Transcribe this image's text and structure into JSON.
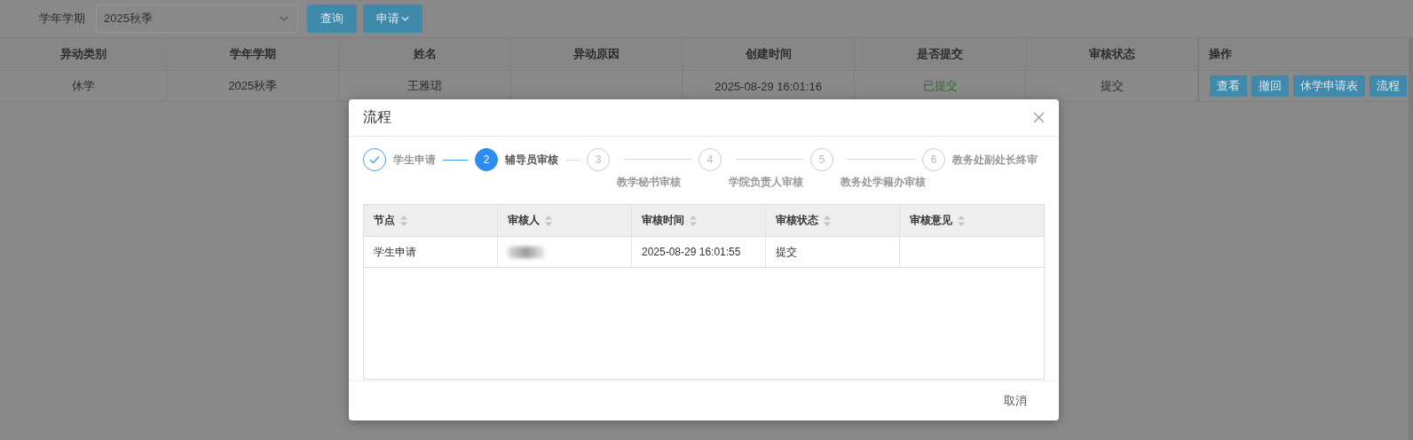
{
  "filter": {
    "label": "学年学期",
    "select_value": "2025秋季",
    "buttons": [
      "查询",
      "申请"
    ]
  },
  "table": {
    "columns": [
      "异动类别",
      "学年学期",
      "姓名",
      "异动原因",
      "创建时间",
      "是否提交",
      "审核状态",
      "操作"
    ],
    "rows": [
      {
        "cells": [
          "休学",
          "2025秋季",
          "王雅珺",
          "",
          "2025-08-29 16:01:16",
          "已提交",
          "提交"
        ],
        "actions": [
          "查看",
          "撤回",
          "休学申请表",
          "流程"
        ]
      }
    ]
  },
  "dialog": {
    "title": "流程",
    "steps": [
      {
        "title": "学生申请",
        "finished": true,
        "selected": false
      },
      {
        "number": "2",
        "title": "辅导员审核",
        "finished": false,
        "selected": true
      },
      {
        "number": "3",
        "title": "教学秘书审核",
        "finished": false,
        "selected": false
      },
      {
        "number": "4",
        "title": "学院负责人审核",
        "finished": false,
        "selected": false
      },
      {
        "number": "5",
        "title": "教务处学籍办审核",
        "finished": false,
        "selected": false
      },
      {
        "number": "6",
        "title": "教务处副处长终审",
        "finished": false,
        "selected": false
      }
    ],
    "table": {
      "columns": [
        "节点",
        "审核人",
        "审核时间",
        "审核状态",
        "审核意见"
      ],
      "rows": [
        {
          "cells": [
            "学生申请",
            {
              "kind": "blurred"
            },
            "2025-08-29 16:01:55",
            "提交",
            ""
          ]
        }
      ]
    },
    "buttons": [
      "取消"
    ]
  }
}
